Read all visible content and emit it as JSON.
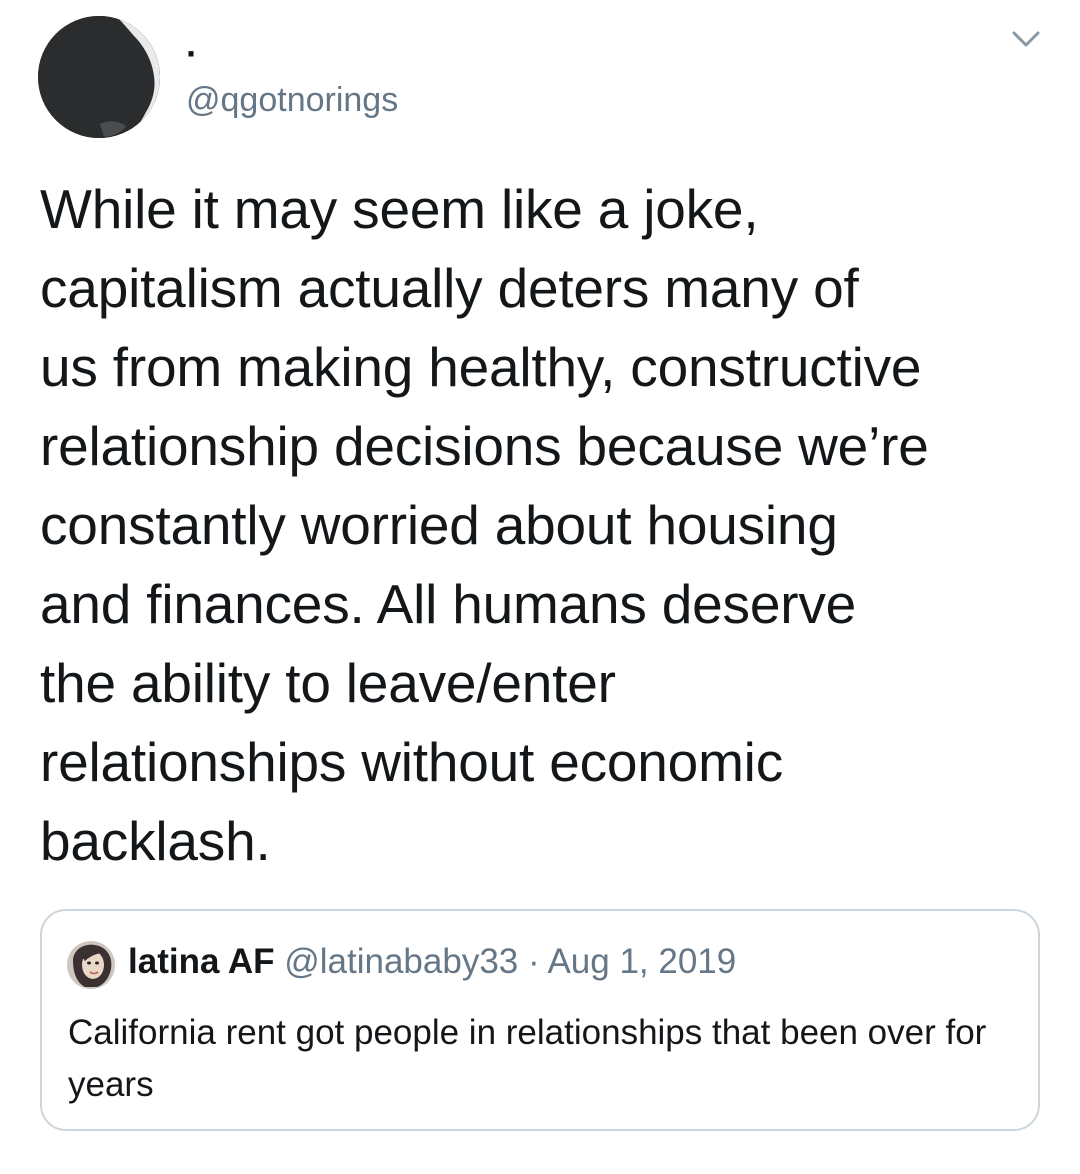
{
  "author": {
    "display_name": "·",
    "handle": "@qgotnorings",
    "avatar_icon": "silhouette-avatar-icon"
  },
  "menu": {
    "icon": "chevron-down-icon"
  },
  "tweet": {
    "text": "While it may seem like a joke,\ncapitalism actually deters many of\nus from making healthy, constructive\nrelationship decisions because we’re\nconstantly worried about housing\nand finances. All humans deserve\nthe ability to leave/enter\nrelationships without economic\nbacklash."
  },
  "quoted_tweet": {
    "display_name": "latina AF",
    "handle": "@latinababy33",
    "separator": " · ",
    "date": "Aug 1, 2019",
    "text": "California rent got people in relationships that been over for years",
    "avatar_icon": "profile-photo-icon"
  },
  "colors": {
    "text": "#14171a",
    "secondary": "#657786",
    "border": "#ccd6dd",
    "background": "#ffffff"
  }
}
